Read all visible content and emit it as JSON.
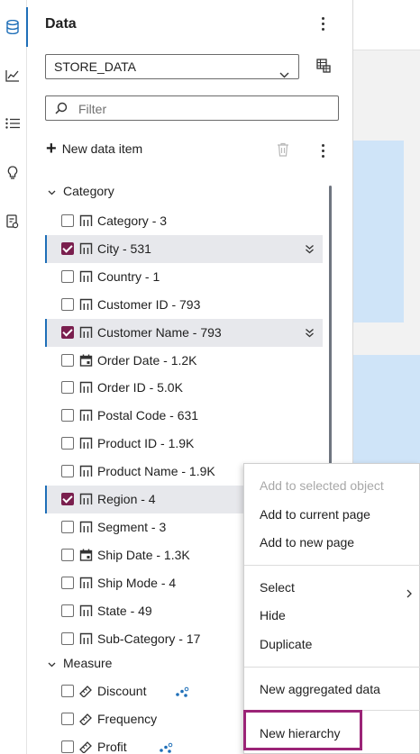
{
  "rail": {
    "icons": [
      "database-icon",
      "line-chart-icon",
      "list-icon",
      "lightbulb-icon",
      "report-icon"
    ]
  },
  "pane": {
    "title": "Data",
    "data_source": "STORE_DATA",
    "filter_placeholder": "Filter",
    "new_data_item": "New data item"
  },
  "groups": {
    "category": "Category",
    "measure": "Measure"
  },
  "items": [
    {
      "label": "Category - 3",
      "checked": false,
      "type": "category"
    },
    {
      "label": "City - 531",
      "checked": true,
      "type": "category"
    },
    {
      "label": "Country - 1",
      "checked": false,
      "type": "category"
    },
    {
      "label": "Customer ID - 793",
      "checked": false,
      "type": "category"
    },
    {
      "label": "Customer Name - 793",
      "checked": true,
      "type": "category"
    },
    {
      "label": "Order Date - 1.2K",
      "checked": false,
      "type": "date"
    },
    {
      "label": "Order ID - 5.0K",
      "checked": false,
      "type": "category"
    },
    {
      "label": "Postal Code - 631",
      "checked": false,
      "type": "category"
    },
    {
      "label": "Product ID - 1.9K",
      "checked": false,
      "type": "category"
    },
    {
      "label": "Product Name - 1.9K",
      "checked": false,
      "type": "category"
    },
    {
      "label": "Region - 4",
      "checked": true,
      "type": "category"
    },
    {
      "label": "Segment - 3",
      "checked": false,
      "type": "category"
    },
    {
      "label": "Ship Date - 1.3K",
      "checked": false,
      "type": "date"
    },
    {
      "label": "Ship Mode - 4",
      "checked": false,
      "type": "category"
    },
    {
      "label": "State - 49",
      "checked": false,
      "type": "category"
    },
    {
      "label": "Sub-Category - 17",
      "checked": false,
      "type": "category"
    }
  ],
  "measures": [
    {
      "label": "Discount",
      "checked": false
    },
    {
      "label": "Frequency",
      "checked": false
    },
    {
      "label": "Profit",
      "checked": false
    }
  ],
  "menu": {
    "add_selected": "Add to selected object",
    "add_current": "Add to current page",
    "add_new": "Add to new page",
    "select": "Select",
    "hide": "Hide",
    "duplicate": "Duplicate",
    "new_aggregated": "New aggregated data",
    "new_hierarchy": "New hierarchy"
  },
  "colors": {
    "accent": "#1f6fb8",
    "checkbox_checked": "#7a1f4e",
    "highlight_border": "#9b2477",
    "canvas_block": "#cfe4f8"
  }
}
